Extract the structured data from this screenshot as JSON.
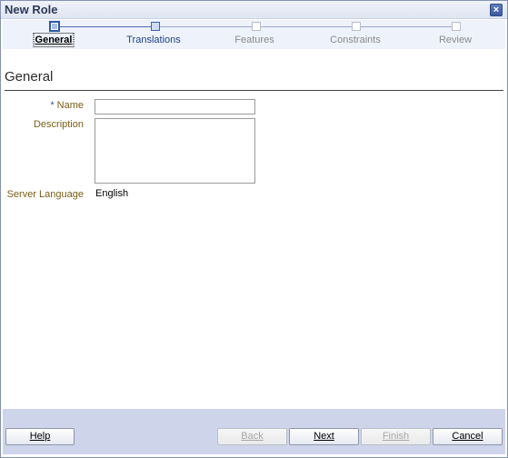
{
  "window": {
    "title": "New Role",
    "close_glyph": "×"
  },
  "train": {
    "stops": [
      {
        "label": "General",
        "state": "current"
      },
      {
        "label": "Translations",
        "state": "next"
      },
      {
        "label": "Features",
        "state": "unvisited"
      },
      {
        "label": "Constraints",
        "state": "unvisited"
      },
      {
        "label": "Review",
        "state": "unvisited"
      }
    ]
  },
  "section": {
    "title": "General"
  },
  "form": {
    "name": {
      "required_marker": "*",
      "label": "Name",
      "value": ""
    },
    "description": {
      "label": "Description",
      "value": ""
    },
    "server_language": {
      "label": "Server Language",
      "value": "English"
    }
  },
  "buttons": {
    "help": "Help",
    "back": "Back",
    "next": "Next",
    "finish": "Finish",
    "cancel": "Cancel"
  },
  "colors": {
    "accent": "#2c58a8",
    "label": "#7a5d16",
    "footer": "#ced5ea"
  }
}
